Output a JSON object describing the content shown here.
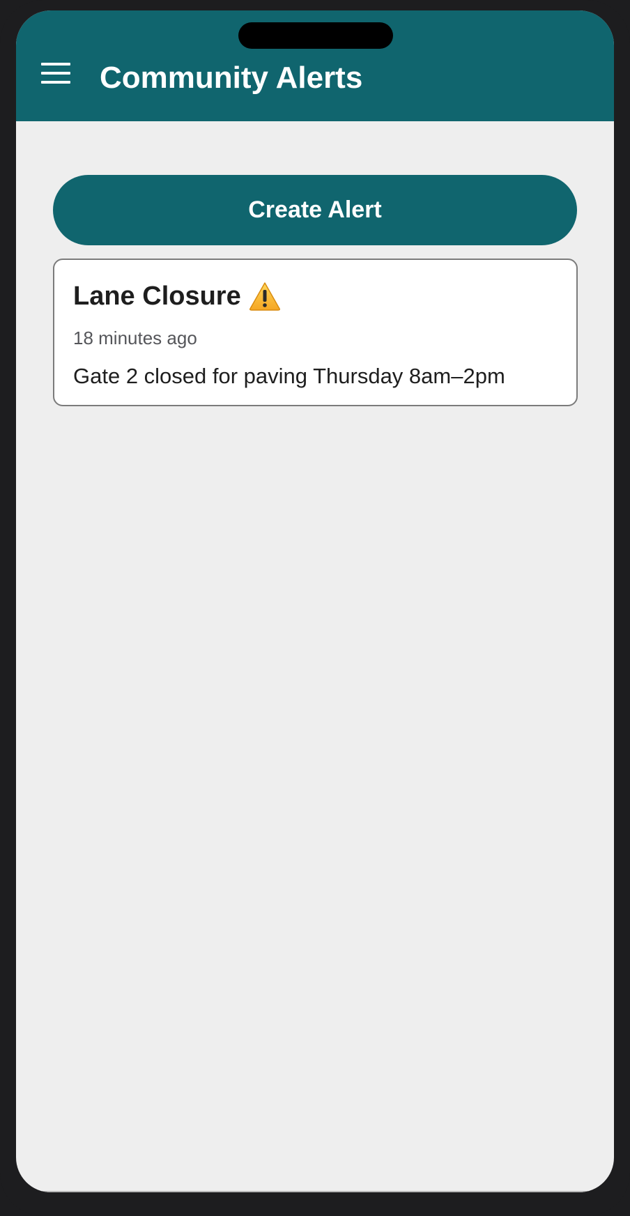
{
  "app_bar": {
    "title": "Community Alerts",
    "background_color": "#10656e",
    "menu_icon": "hamburger-menu-icon"
  },
  "actions": {
    "create_label": "Create Alert"
  },
  "alerts": [
    {
      "title": "Lane Closure",
      "icon": "warning-icon",
      "time": "18 minutes ago",
      "body": "Gate 2 closed for paving Thursday 8am–2pm"
    }
  ],
  "colors": {
    "accent": "#10656e",
    "page_background": "#eeeeee",
    "card_background": "#ffffff",
    "warning": "#f5b323"
  }
}
